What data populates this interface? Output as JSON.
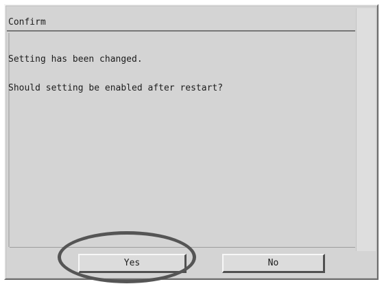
{
  "dialog": {
    "title": "Confirm",
    "message_lines": [
      "Setting has been changed.",
      "Should setting be enabled after restart?"
    ],
    "buttons": {
      "yes_label": "Yes",
      "no_label": "No"
    }
  },
  "colors": {
    "dialog_background": "#d4d4d4",
    "highlight_ring": "#555555"
  }
}
